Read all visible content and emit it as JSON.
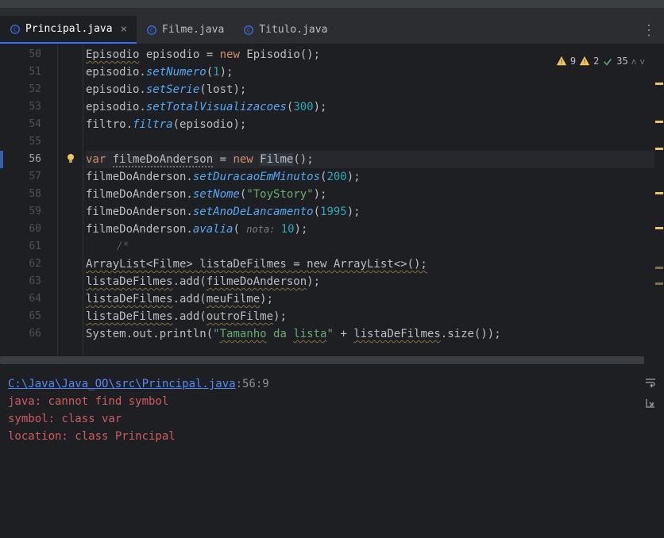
{
  "tabs": {
    "principal": "Principal.java",
    "filme": "Filme.java",
    "titulo": "Titulo.java"
  },
  "status": {
    "errors": "9",
    "warnings": "2",
    "weak": "35"
  },
  "lines": {
    "l50": "50",
    "l51": "51",
    "l52": "52",
    "l53": "53",
    "l54": "54",
    "l55": "55",
    "l56": "56",
    "l57": "57",
    "l58": "58",
    "l59": "59",
    "l60": "60",
    "l61": "61",
    "l62": "62",
    "l63": "63",
    "l64": "64",
    "l65": "65",
    "l66": "66"
  },
  "code": {
    "l50_a": "Episodio",
    "l50_b": " episodio = ",
    "l50_c": "new ",
    "l50_d": "Episodio",
    "l50_e": "()",
    "l50_f": ";",
    "l51_a": "episodio.",
    "l51_b": "setNumero",
    "l51_c": "(",
    "l51_d": "1",
    "l51_e": ")",
    "l51_f": ";",
    "l52_a": "episodio.",
    "l52_b": "setSerie",
    "l52_c": "(",
    "l52_d": "lost",
    "l52_e": ")",
    "l52_f": ";",
    "l53_a": "episodio.",
    "l53_b": "setTotalVisualizacoes",
    "l53_c": "(",
    "l53_d": "300",
    "l53_e": ")",
    "l53_f": ";",
    "l54_a": "filtro.",
    "l54_b": "filtra",
    "l54_c": "(",
    "l54_d": "episodio",
    "l54_e": ")",
    "l54_f": ";",
    "l56_a": "var ",
    "l56_b": "filmeDoAnderson",
    "l56_c": " = ",
    "l56_d": "new ",
    "l56_e": "Filme",
    "l56_f": "()",
    "l56_g": ";",
    "l57_a": "filmeDoAnderson.",
    "l57_b": "setDuracaoEmMinutos",
    "l57_c": "(",
    "l57_d": "200",
    "l57_e": ")",
    "l57_f": ";",
    "l58_a": "filmeDoAnderson.",
    "l58_b": "setNome",
    "l58_c": "(",
    "l58_d": "\"ToyStory\"",
    "l58_e": ")",
    "l58_f": ";",
    "l59_a": "filmeDoAnderson.",
    "l59_b": "setAnoDeLancamento",
    "l59_c": "(",
    "l59_d": "1995",
    "l59_e": ")",
    "l59_f": ";",
    "l60_a": "filmeDoAnderson.",
    "l60_b": "avalia",
    "l60_c": "( ",
    "l60_hint": "nota: ",
    "l60_d": "10",
    "l60_e": ")",
    "l60_f": ";",
    "l61_a": "/*",
    "l62_a": "ArrayList<Filme> listaDeFilmes = new ArrayList<>();",
    "l63_a": "listaDeFilmes",
    "l63_b": ".add(",
    "l63_c": "filmeDoAnderson",
    "l63_d": ");",
    "l64_a": "listaDeFilmes",
    "l64_b": ".add(",
    "l64_c": "meuFilme",
    "l64_d": ");",
    "l65_a": "listaDeFilmes",
    "l65_b": ".add(",
    "l65_c": "outroFilme",
    "l65_d": ");",
    "l66_a": "System.out.println(",
    "l66_b": "\"",
    "l66_c": "Tamanho",
    "l66_d": " da ",
    "l66_e": "lista",
    "l66_f": "\" ",
    "l66_g": "+ ",
    "l66_h": "listaDeFilmes",
    "l66_i": ".size());"
  },
  "problems": {
    "file_path": "C:\\Java\\Java_OO\\src\\Principal.java",
    "pos": ":56:9",
    "msg": "java: cannot find symbol",
    "symbol": "  symbol:   class var",
    "location": "  location: class Principal"
  }
}
